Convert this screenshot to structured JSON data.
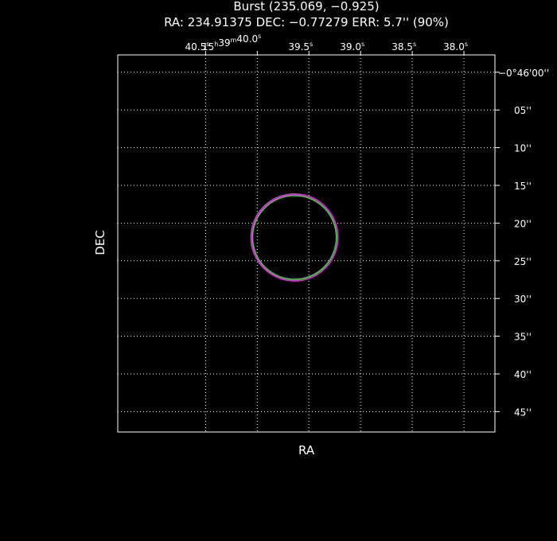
{
  "title": "Burst (235.069, −0.925)",
  "subtitle": "RA: 234.91375   DEC: −0.77279   ERR: 5.7'' (90%)",
  "xlabel": "RA",
  "ylabel": "DEC",
  "colors": {
    "background": "#000000",
    "frame": "#ffffff",
    "outer_circle": "#cc33cc",
    "inner_circle": "#33cc33"
  },
  "chart_data": {
    "type": "scatter",
    "title": "Burst (235.069, −0.925)",
    "subtitle": "RA: 234.91375   DEC: −0.77279   ERR: 5.7'' (90%)",
    "xlabel": "RA",
    "ylabel": "DEC",
    "grid": true,
    "x_ticks": [
      {
        "main": "40.5",
        "unit": "s"
      },
      {
        "main": "15",
        "unit": "h",
        "main2": "39",
        "unit2": "m",
        "main3": "40.0",
        "unit3": "s"
      },
      {
        "main": "39.5",
        "unit": "s"
      },
      {
        "main": "39.0",
        "unit": "s"
      },
      {
        "main": "38.5",
        "unit": "s"
      },
      {
        "main": "38.0",
        "unit": "s"
      }
    ],
    "x_tick_seconds": [
      40.5,
      40.0,
      39.5,
      39.0,
      38.5,
      38.0
    ],
    "y_ticks": [
      "−0°46'00''",
      "05''",
      "10''",
      "15''",
      "20''",
      "25''",
      "30''",
      "35''",
      "40''",
      "45''"
    ],
    "y_tick_arcsec": [
      0,
      5,
      10,
      15,
      20,
      25,
      30,
      35,
      40,
      45
    ],
    "xlim_seconds": [
      41.35,
      37.7
    ],
    "ylim_arcsec": [
      -2.3,
      47.7
    ],
    "error_circle": {
      "ra_seconds": 39.64,
      "dec_arcsec": 21.9,
      "radius_arcsec": 5.7
    }
  }
}
